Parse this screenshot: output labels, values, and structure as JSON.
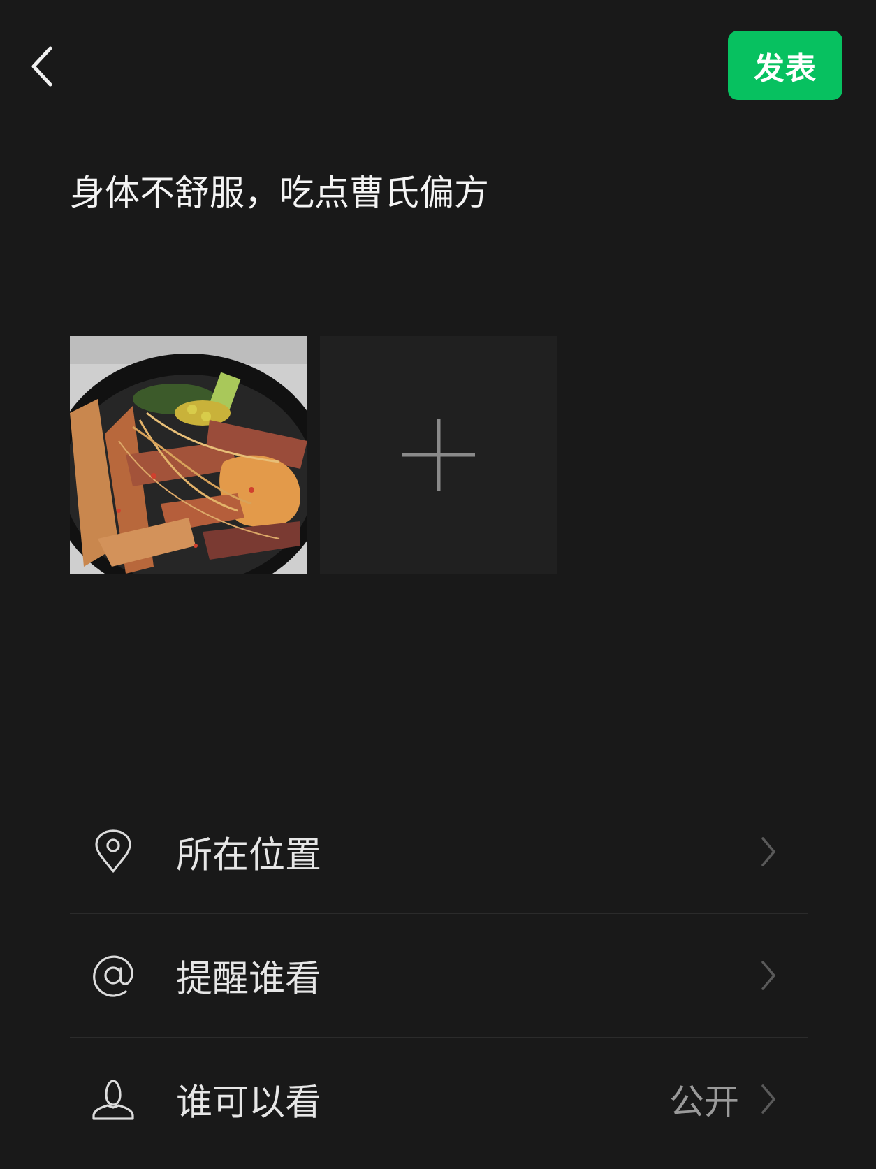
{
  "header": {
    "back_icon": "chevron-left-icon",
    "publish_label": "发表",
    "publish_color": "#07c160"
  },
  "post": {
    "text": "身体不舒服，吃点曹氏偏方"
  },
  "photos": {
    "thumbnail_description_icon": "photo-thumbnail",
    "add_icon": "plus-icon"
  },
  "options": [
    {
      "icon": "location-pin-icon",
      "label": "所在位置",
      "value": ""
    },
    {
      "icon": "at-sign-icon",
      "label": "提醒谁看",
      "value": ""
    },
    {
      "icon": "person-icon",
      "label": "谁可以看",
      "value": "公开"
    }
  ],
  "colors": {
    "background": "#191919",
    "accent": "#07c160"
  }
}
